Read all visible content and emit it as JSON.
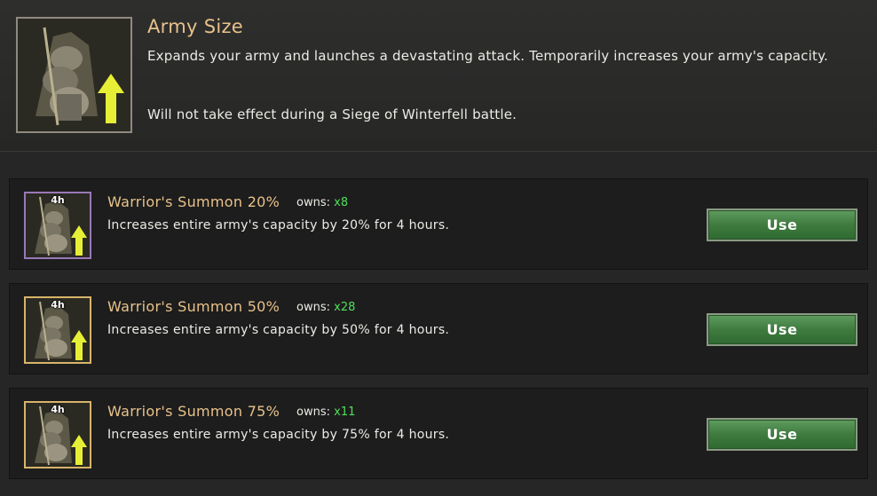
{
  "header": {
    "title": "Army Size",
    "description": "Expands your army and launches a devastating attack. Temporarily increases your army's capacity.",
    "note": "Will not take effect during a Siege of Winterfell battle.",
    "icon": "warrior-summon-icon"
  },
  "items": [
    {
      "name": "Warrior's Summon 20%",
      "owns_label": "owns:",
      "count": "x8",
      "description": "Increases entire army's capacity by 20% for 4 hours.",
      "duration": "4h",
      "use_label": "Use",
      "frame_color": "#9a78b8"
    },
    {
      "name": "Warrior's Summon 50%",
      "owns_label": "owns:",
      "count": "x28",
      "description": "Increases entire army's capacity by 50% for 4 hours.",
      "duration": "4h",
      "use_label": "Use",
      "frame_color": "#d8b46a"
    },
    {
      "name": "Warrior's Summon 75%",
      "owns_label": "owns:",
      "count": "x11",
      "description": "Increases entire army's capacity by 75% for 4 hours.",
      "duration": "4h",
      "use_label": "Use",
      "frame_color": "#d8b46a"
    }
  ],
  "colors": {
    "title_gold": "#e8c28a",
    "count_green": "#4fe05a",
    "button_green": "#3f7b3f"
  }
}
